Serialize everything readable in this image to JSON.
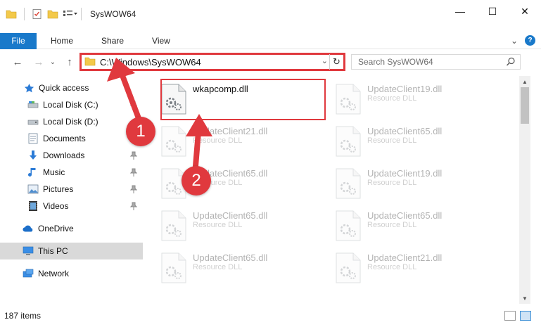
{
  "window": {
    "title": "SysWOW64",
    "minimize": "—",
    "maximize": "☐",
    "close": "✕"
  },
  "ribbon": {
    "file_tab": "File",
    "tabs": [
      "Home",
      "Share",
      "View"
    ],
    "collapse": "⌄",
    "help": "?"
  },
  "nav": {
    "back": "←",
    "forward": "→",
    "recent": "⌄",
    "up": "↑",
    "address_path": "C:\\Windows\\SysWOW64",
    "address_dropdown": "⌄",
    "refresh": "↻",
    "search_placeholder": "Search SysWOW64"
  },
  "sidebar": {
    "items": [
      {
        "label": "Quick access",
        "icon": "star-icon"
      },
      {
        "label": "Local Disk (C:)",
        "icon": "drive-icon"
      },
      {
        "label": "Local Disk (D:)",
        "icon": "drive-icon"
      },
      {
        "label": "Documents",
        "icon": "documents-icon"
      },
      {
        "label": "Downloads",
        "icon": "download-icon"
      },
      {
        "label": "Music",
        "icon": "music-icon"
      },
      {
        "label": "Pictures",
        "icon": "pictures-icon"
      },
      {
        "label": "Videos",
        "icon": "videos-icon"
      },
      {
        "label": "OneDrive",
        "icon": "cloud-icon"
      },
      {
        "label": "This PC",
        "icon": "computer-icon"
      },
      {
        "label": "Network",
        "icon": "network-icon"
      }
    ]
  },
  "files": [
    {
      "name": "wkapcomp.dll",
      "type": ""
    },
    {
      "name": "UpdateClient19.dll",
      "type": "Resource DLL"
    },
    {
      "name": "UpdateClient21.dll",
      "type": "Resource DLL"
    },
    {
      "name": "UpdateClient65.dll",
      "type": "Resource DLL"
    },
    {
      "name": "UpdateClient65.dll",
      "type": "Resource DLL"
    },
    {
      "name": "UpdateClient19.dll",
      "type": "Resource DLL"
    },
    {
      "name": "UpdateClient65.dll",
      "type": "Resource DLL"
    },
    {
      "name": "UpdateClient65.dll",
      "type": "Resource DLL"
    },
    {
      "name": "UpdateClient65.dll",
      "type": "Resource DLL"
    },
    {
      "name": "UpdateClient21.dll",
      "type": "Resource DLL"
    }
  ],
  "status": {
    "item_count": "187 items"
  },
  "callouts": {
    "one": "1",
    "two": "2"
  },
  "colors": {
    "accent": "#1979ca",
    "highlight_red": "#e0393e",
    "selected_bg": "#d9d9d9"
  }
}
